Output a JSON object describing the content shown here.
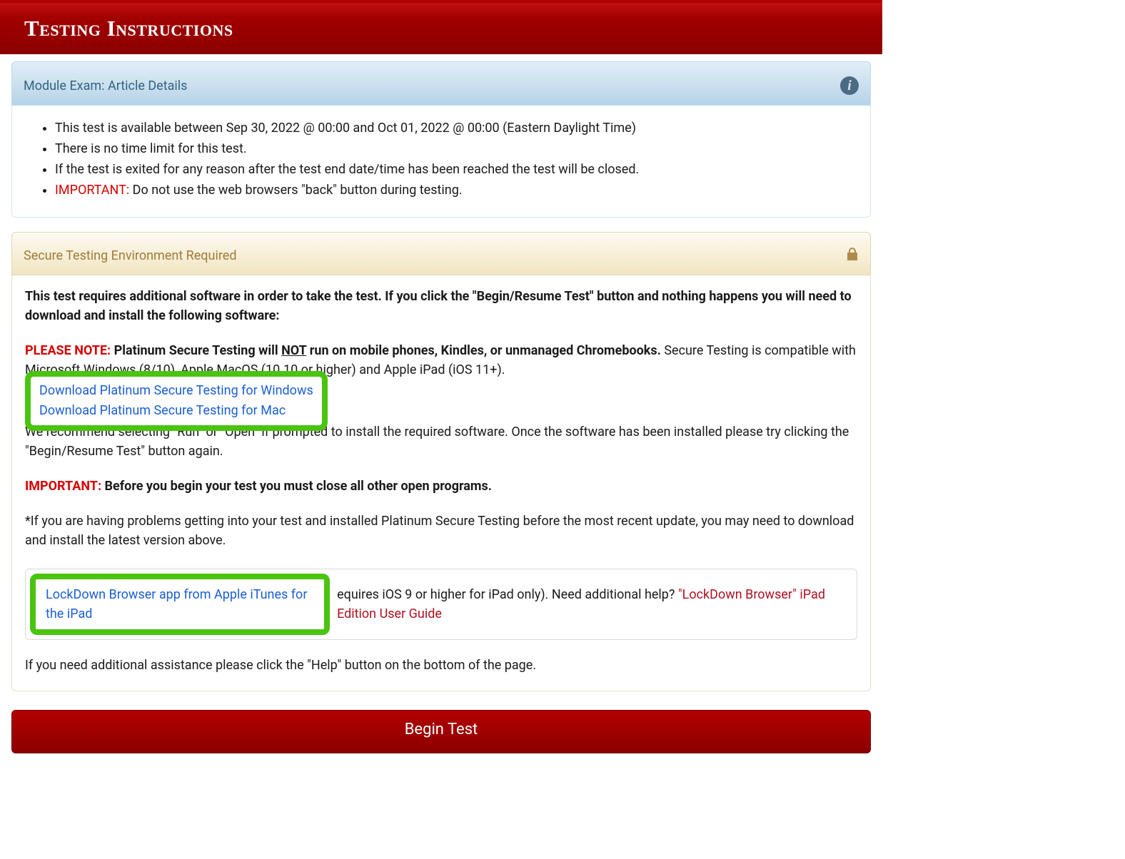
{
  "banner": {
    "title": "Testing Instructions"
  },
  "module": {
    "header": "Module Exam: Article Details",
    "bullets": [
      "This test is available between Sep 30, 2022 @ 00:00 and Oct 01, 2022 @ 00:00 (Eastern Daylight Time)",
      "There is no time limit for this test.",
      "If the test is exited for any reason after the test end date/time has been reached the test will be closed."
    ],
    "important_label": "IMPORTANT:",
    "important_text": " Do not use the web browsers \"back\" button during testing."
  },
  "secure": {
    "header": "Secure Testing Environment Required",
    "intro": "This test requires additional software in order to take the test. If you click the \"Begin/Resume Test\" button and nothing happens you will need to download and install the following software:",
    "please_note_label": "PLEASE NOTE:",
    "please_note_bold_pre": " Platinum Secure Testing will ",
    "please_note_not": "NOT",
    "please_note_bold_post": " run on mobile phones, Kindles, or unmanaged Chromebooks.",
    "please_note_tail": " Secure Testing is compatible with Microsoft Windows (8/10), Apple MacOS (10.10 or higher) and Apple iPad (iOS 11+).",
    "download_win": "Download Platinum Secure Testing for Windows",
    "download_mac": "Download Platinum Secure Testing for Mac",
    "recommend": "We recommend selecting \"Run\" or \"Open\" if prompted to install the required software. Once the software has been installed please try clicking the \"Begin/Resume Test\" button again.",
    "important2_label": "IMPORTANT:",
    "important2_text": " Before you begin your test you must close all other open programs.",
    "asterisk": "*If you are having problems getting into your test and installed Platinum Secure Testing before the most recent update, you may need to download and install the latest version above.",
    "ipad_link": "LockDown Browser app from Apple iTunes for the iPad",
    "ipad_mid": "equires iOS 9 or higher for iPad only). Need additional help? ",
    "ipad_guide": "\"LockDown Browser\" iPad Edition User Guide",
    "assist": "If you need additional assistance please click the \"Help\" button on the bottom of the page."
  },
  "button": {
    "begin": "Begin Test"
  }
}
